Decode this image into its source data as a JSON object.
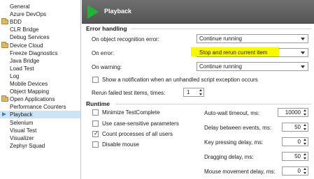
{
  "tree": {
    "items": [
      {
        "label": "General",
        "icon": "none",
        "selected": false
      },
      {
        "label": "Azure DevOps",
        "icon": "none",
        "selected": false
      },
      {
        "label": "BDD",
        "icon": "folder-icon",
        "selected": false
      },
      {
        "label": "CLR Bridge",
        "icon": "none",
        "selected": false
      },
      {
        "label": "Debug Services",
        "icon": "none",
        "selected": false
      },
      {
        "label": "Device Cloud",
        "icon": "folder-icon",
        "selected": false
      },
      {
        "label": "Freeze Diagnostics",
        "icon": "none",
        "selected": false
      },
      {
        "label": "Java Bridge",
        "icon": "none",
        "selected": false
      },
      {
        "label": "Load Test",
        "icon": "none",
        "selected": false
      },
      {
        "label": "Log",
        "icon": "none",
        "selected": false
      },
      {
        "label": "Mobile Devices",
        "icon": "none",
        "selected": false
      },
      {
        "label": "Object Mapping",
        "icon": "none",
        "selected": false
      },
      {
        "label": "Open Applications",
        "icon": "folder-icon",
        "selected": false
      },
      {
        "label": "Performance Counters",
        "icon": "none",
        "selected": false
      },
      {
        "label": "Playback",
        "icon": "selected-arrow-icon",
        "selected": true
      },
      {
        "label": "Selenium",
        "icon": "none",
        "selected": false
      },
      {
        "label": "Visual Test",
        "icon": "none",
        "selected": false
      },
      {
        "label": "Visualizer",
        "icon": "none",
        "selected": false
      },
      {
        "label": "Zephyr Squad",
        "icon": "none",
        "selected": false
      }
    ]
  },
  "header": {
    "title": "Playback",
    "icon": "play-icon",
    "accent": "#20b530"
  },
  "error_handling": {
    "section_title": "Error handling",
    "object_recognition_label": "On object recognition error:",
    "object_recognition_value": "Continue running",
    "on_error_label": "On error:",
    "on_error_value": "Stop and rerun current item",
    "on_warning_label": "On warning:",
    "on_warning_value": "Continue running",
    "show_notification_label": "Show a notification when an unhandled script exception occurs",
    "show_notification_checked": false,
    "rerun_label": "Rerun failed test items, times:",
    "rerun_value": "1",
    "highlight_color": "#f8f800"
  },
  "runtime": {
    "section_title": "Runtime",
    "minimize_label": "Minimize TestComplete",
    "minimize_checked": false,
    "case_sensitive_label": "Use case-sensitive parameters",
    "case_sensitive_checked": false,
    "count_processes_label": "Count processes of all users",
    "count_processes_checked": true,
    "disable_mouse_label": "Disable mouse",
    "disable_mouse_checked": false,
    "auto_wait_label": "Auto-wait timeout, ms:",
    "auto_wait_value": "10000",
    "delay_events_label": "Delay between events, ms:",
    "delay_events_value": "50",
    "key_pressing_label": "Key pressing delay, ms:",
    "key_pressing_value": "0",
    "dragging_label": "Dragging delay, ms:",
    "dragging_value": "50",
    "mouse_movement_label": "Mouse movement delay, ms:",
    "mouse_movement_value": "0"
  }
}
